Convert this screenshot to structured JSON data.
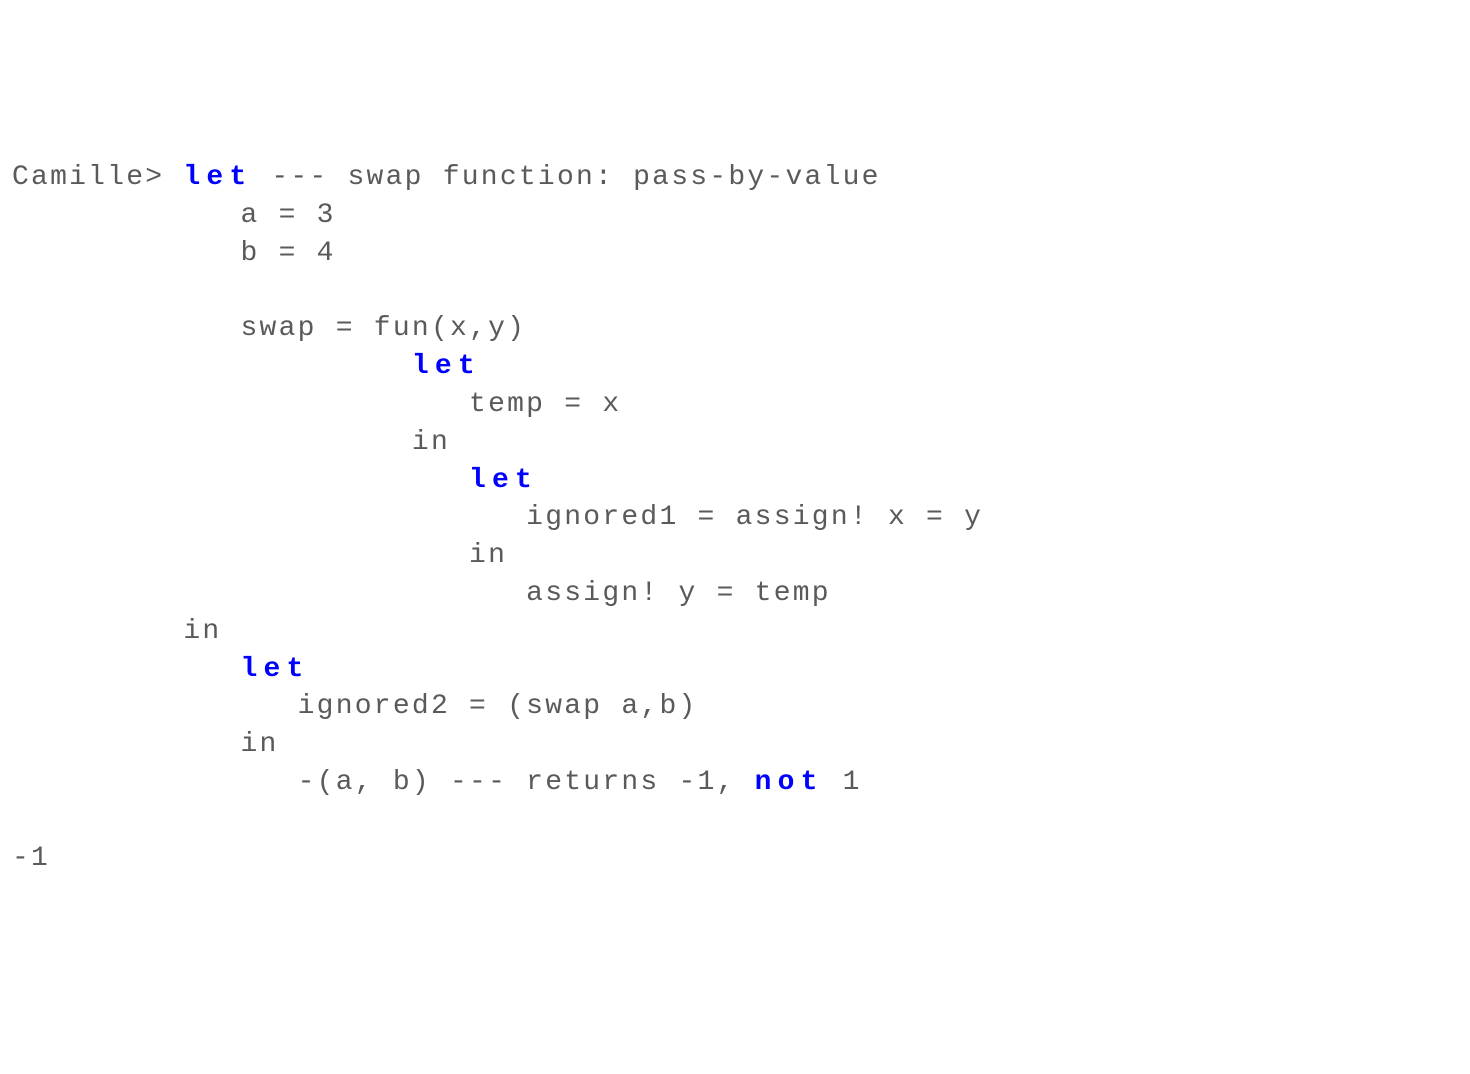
{
  "code": {
    "l1_prompt": "Camille> ",
    "l1_kw": "let",
    "l1_rest": " --- swap function: pass-by-value",
    "l2": "            a = 3",
    "l3": "            b = 4",
    "l4": "",
    "l5": "            swap = fun(x,y)",
    "l6_indent": "                     ",
    "l6_kw": "let",
    "l7": "                        temp = x",
    "l8": "                     in",
    "l9_indent": "                        ",
    "l9_kw": "let",
    "l10": "                           ignored1 = assign! x = y",
    "l11": "                        in",
    "l12": "                           assign! y = temp",
    "l13": "         in",
    "l14_indent": "            ",
    "l14_kw": "let",
    "l15": "               ignored2 = (swap a,b)",
    "l16": "            in",
    "l17a": "               -(a, b) --- returns -1, ",
    "l17_kw": "not",
    "l17b": " 1",
    "l18": "",
    "l19": "-1"
  }
}
